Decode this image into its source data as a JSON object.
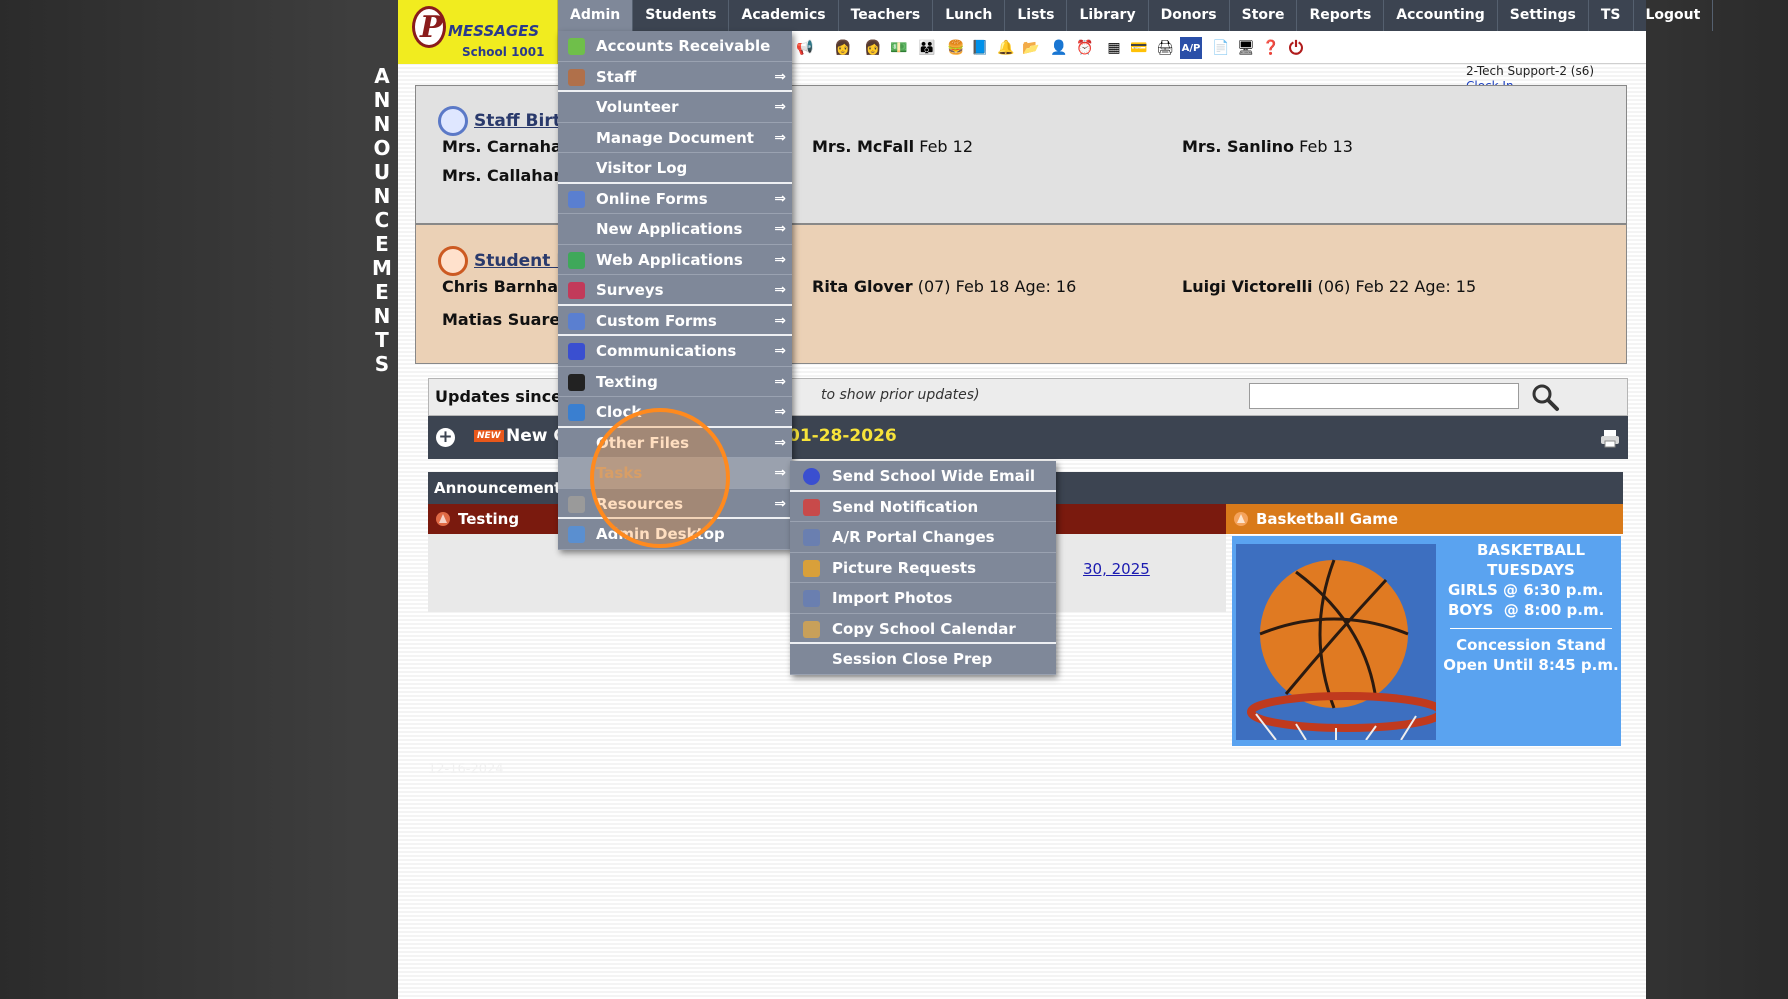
{
  "announcements_vertical": [
    "A",
    "N",
    "N",
    "O",
    "U",
    "N",
    "C",
    "E",
    "M",
    "E",
    "N",
    "T",
    "S"
  ],
  "logo": {
    "brand": "MESSAGES",
    "school": "School 1001"
  },
  "nav": {
    "items": [
      "Admin",
      "Students",
      "Academics",
      "Teachers",
      "Lunch",
      "Lists",
      "Library",
      "Donors",
      "Store",
      "Reports",
      "Accounting",
      "Settings",
      "TS",
      "Logout"
    ],
    "active": "Admin"
  },
  "user": {
    "name": "2-Tech Support-2 (s6)",
    "clock_in": "Clock In"
  },
  "staff_birthdays": {
    "title": "Staff Birt",
    "entries": [
      {
        "name": "Mrs. Carnahan",
        "date": ""
      },
      {
        "name": "Mrs. Callahan",
        "date": ""
      },
      {
        "name": "Mrs. McFall",
        "date": "Feb 12"
      },
      {
        "name": "Mrs. Sanlino",
        "date": "Feb 13"
      }
    ]
  },
  "student_birthdays": {
    "title": "Student B",
    "entries": [
      {
        "name": "Chris Barnhar",
        "detail": ""
      },
      {
        "name": "Matias Suarez",
        "detail": ""
      },
      {
        "name": "Rita Glover",
        "detail": "(07) Feb 18 Age: 16"
      },
      {
        "name": "Luigi Victorelli",
        "detail": "(06) Feb 22 Age: 15"
      }
    ]
  },
  "updates": {
    "label": "Updates since:",
    "hint": "to show prior updates)",
    "search_value": "",
    "new_label": "New C",
    "new_tag": "NEW",
    "date": "01-28-2026"
  },
  "announcements": {
    "header": "Announcements",
    "testing_title": "Testing",
    "testing_link": "30, 2025",
    "basketball_title": "Basketball Game",
    "basketball_lines": [
      "BASKETBALL",
      "TUESDAYS",
      "GIRLS @ 6:30 p.m.",
      "BOYS  @ 8:00 p.m."
    ],
    "concession_lines": [
      "Concession Stand",
      "Open Until 8:45 p.m."
    ],
    "faded_date": "12-16-2024"
  },
  "admin_menu": {
    "items": [
      {
        "label": "Accounts Receivable",
        "icon": "money-icon",
        "submenu": false
      },
      {
        "label": "Staff",
        "icon": "person-icon",
        "submenu": true
      },
      {
        "label": "Volunteer",
        "icon": "",
        "submenu": true
      },
      {
        "label": "Manage Document",
        "icon": "",
        "submenu": true
      },
      {
        "label": "Visitor Log",
        "icon": "",
        "submenu": false
      },
      {
        "label": "Online Forms",
        "icon": "html-icon",
        "submenu": true
      },
      {
        "label": "New Applications",
        "icon": "",
        "submenu": true
      },
      {
        "label": "Web Applications",
        "icon": "globe-icon",
        "submenu": true
      },
      {
        "label": "Surveys",
        "icon": "survey-icon",
        "submenu": true
      },
      {
        "label": "Custom Forms",
        "icon": "html-icon",
        "submenu": true
      },
      {
        "label": "Communications",
        "icon": "at-icon",
        "submenu": true
      },
      {
        "label": "Texting",
        "icon": "phone-icon",
        "submenu": true
      },
      {
        "label": "Clock",
        "icon": "clock-icon",
        "submenu": true
      },
      {
        "label": "Other Files",
        "icon": "",
        "submenu": true
      },
      {
        "label": "Tasks",
        "icon": "",
        "submenu": true
      },
      {
        "label": "Resources",
        "icon": "resources-icon",
        "submenu": true
      },
      {
        "label": "Admin Desktop",
        "icon": "desktop-icon",
        "submenu": false
      }
    ],
    "hovered": "Tasks",
    "arrow": "⇒"
  },
  "tasks_submenu": {
    "items": [
      {
        "label": "Send School Wide Email",
        "icon": "at-icon"
      },
      {
        "label": "Send Notification",
        "icon": "notification-icon"
      },
      {
        "label": "A/R Portal Changes",
        "icon": "portal-icon"
      },
      {
        "label": "Picture Requests",
        "icon": "picture-icon"
      },
      {
        "label": "Import Photos",
        "icon": "import-icon"
      },
      {
        "label": "Copy School Calendar",
        "icon": "calendar-icon"
      },
      {
        "label": "Session Close Prep",
        "icon": ""
      }
    ]
  },
  "colors": {
    "nav_bg": "#3c4451",
    "menu_bg": "#7f8899",
    "accent_orange": "#ff8a1e",
    "staff_panel": "#e1e1e1",
    "student_panel": "#ebd1b6"
  }
}
